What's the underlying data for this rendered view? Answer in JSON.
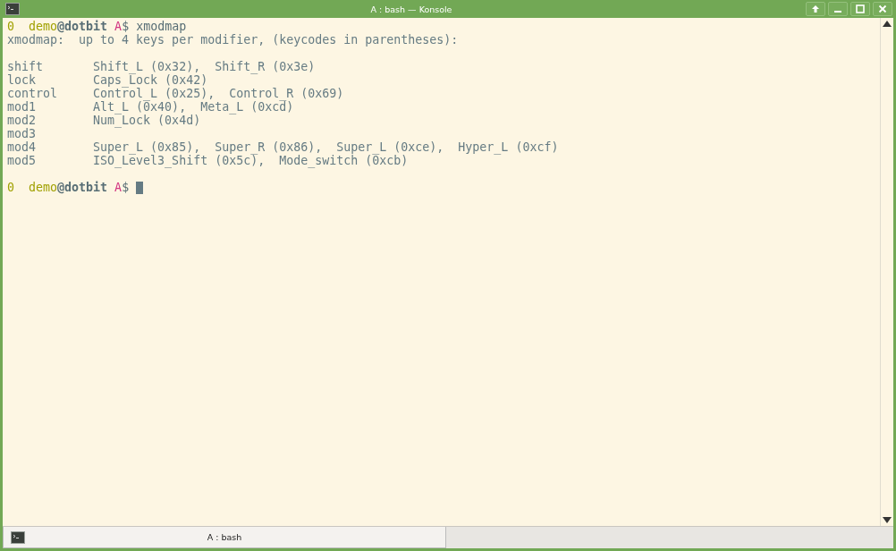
{
  "window": {
    "title": "A : bash — Konsole"
  },
  "terminal": {
    "lines": [
      {
        "kind": "prompt",
        "status": "0",
        "user": "demo",
        "host": "@dotbit",
        "session": "A",
        "symbol": "$",
        "command": " xmodmap"
      },
      {
        "kind": "output",
        "text": "xmodmap:  up to 4 keys per modifier, (keycodes in parentheses):"
      },
      {
        "kind": "blank"
      },
      {
        "kind": "output",
        "text": "shift       Shift_L (0x32),  Shift_R (0x3e)"
      },
      {
        "kind": "output",
        "text": "lock        Caps_Lock (0x42)"
      },
      {
        "kind": "output",
        "text": "control     Control_L (0x25),  Control_R (0x69)"
      },
      {
        "kind": "output",
        "text": "mod1        Alt_L (0x40),  Meta_L (0xcd)"
      },
      {
        "kind": "output",
        "text": "mod2        Num_Lock (0x4d)"
      },
      {
        "kind": "output",
        "text": "mod3"
      },
      {
        "kind": "output",
        "text": "mod4        Super_L (0x85),  Super_R (0x86),  Super_L (0xce),  Hyper_L (0xcf)"
      },
      {
        "kind": "output",
        "text": "mod5        ISO_Level3_Shift (0x5c),  Mode_switch (0xcb)"
      },
      {
        "kind": "blank"
      },
      {
        "kind": "prompt",
        "status": "0",
        "user": "demo",
        "host": "@dotbit",
        "session": "A",
        "symbol": "$",
        "cursor": true
      }
    ]
  },
  "tabs": [
    {
      "label": "A : bash",
      "selected": true
    }
  ]
}
